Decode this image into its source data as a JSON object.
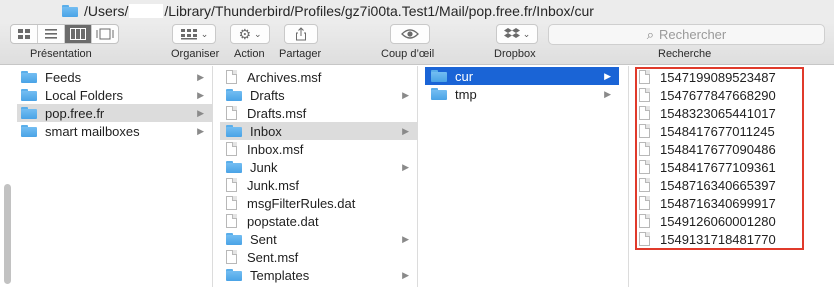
{
  "titlebar": {
    "path_prefix": "/Users/",
    "path_suffix": "/Library/Thunderbird/Profiles/gz7i00ta.Test1/Mail/pop.free.fr/Inbox/cur"
  },
  "toolbar": {
    "presentation_label": "Présentation",
    "organiser_label": "Organiser",
    "action_label": "Action",
    "partager_label": "Partager",
    "coup_doeil_label": "Coup d’œil",
    "dropbox_label": "Dropbox",
    "recherche_label": "Recherche",
    "search_placeholder": "Rechercher"
  },
  "columns": {
    "col1": [
      {
        "label": "Feeds",
        "type": "folder",
        "has_children": true
      },
      {
        "label": "Local Folders",
        "type": "folder",
        "has_children": true
      },
      {
        "label": "pop.free.fr",
        "type": "folder",
        "has_children": true,
        "selected": "grey"
      },
      {
        "label": "smart mailboxes",
        "type": "folder",
        "has_children": true
      }
    ],
    "col2": [
      {
        "label": "Archives.msf",
        "type": "file"
      },
      {
        "label": "Drafts",
        "type": "folder",
        "has_children": true
      },
      {
        "label": "Drafts.msf",
        "type": "file"
      },
      {
        "label": "Inbox",
        "type": "folder",
        "has_children": true,
        "selected": "grey"
      },
      {
        "label": "Inbox.msf",
        "type": "file"
      },
      {
        "label": "Junk",
        "type": "folder",
        "has_children": true
      },
      {
        "label": "Junk.msf",
        "type": "file"
      },
      {
        "label": "msgFilterRules.dat",
        "type": "file"
      },
      {
        "label": "popstate.dat",
        "type": "file"
      },
      {
        "label": "Sent",
        "type": "folder",
        "has_children": true
      },
      {
        "label": "Sent.msf",
        "type": "file"
      },
      {
        "label": "Templates",
        "type": "folder",
        "has_children": true
      }
    ],
    "col3": [
      {
        "label": "cur",
        "type": "folder",
        "has_children": true,
        "selected": "blue"
      },
      {
        "label": "tmp",
        "type": "folder",
        "has_children": true
      }
    ],
    "col4": [
      {
        "label": "1547199089523487",
        "type": "file"
      },
      {
        "label": "1547677847668290",
        "type": "file"
      },
      {
        "label": "1548323065441017",
        "type": "file"
      },
      {
        "label": "1548417677011245",
        "type": "file"
      },
      {
        "label": "1548417677090486",
        "type": "file"
      },
      {
        "label": "1548417677109361",
        "type": "file"
      },
      {
        "label": "1548716340665397",
        "type": "file"
      },
      {
        "label": "1548716340699917",
        "type": "file"
      },
      {
        "label": "1549126060001280",
        "type": "file"
      },
      {
        "label": "1549131718481770",
        "type": "file"
      }
    ]
  },
  "colors": {
    "selection_blue": "#1a64d6",
    "selection_grey": "#dcdcdc",
    "highlight_red": "#e03a2b",
    "folder_blue": "#5aaeea"
  }
}
